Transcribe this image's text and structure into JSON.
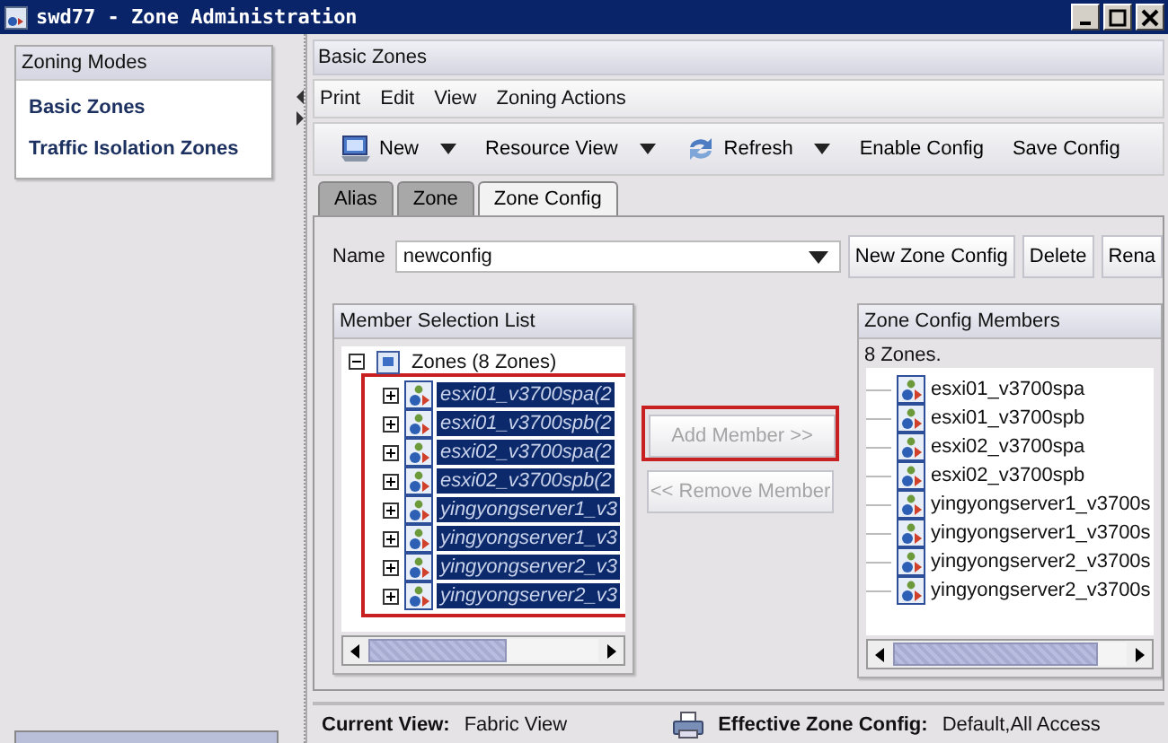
{
  "window": {
    "title": "swd77 - Zone Administration"
  },
  "sidebar": {
    "title": "Zoning Modes",
    "items": [
      {
        "label": "Basic Zones"
      },
      {
        "label": "Traffic Isolation Zones"
      }
    ]
  },
  "main": {
    "title": "Basic Zones",
    "menu": [
      "Print",
      "Edit",
      "View",
      "Zoning Actions"
    ],
    "toolbar": [
      {
        "label": "New",
        "kind": "icon_dropdown"
      },
      {
        "label": "Resource View",
        "kind": "dropdown"
      },
      {
        "label": "Refresh",
        "kind": "icon_dropdown"
      },
      {
        "label": "Enable Config",
        "kind": "plain"
      },
      {
        "label": "Save Config",
        "kind": "plain"
      }
    ],
    "tabs": [
      {
        "label": "Alias",
        "selected": false
      },
      {
        "label": "Zone",
        "selected": false
      },
      {
        "label": "Zone Config",
        "selected": true
      }
    ],
    "name_field": {
      "label": "Name",
      "value": "newconfig"
    },
    "buttons": [
      "New Zone Config",
      "Delete",
      "Rena"
    ],
    "member_list": {
      "title": "Member Selection List",
      "highlighted": true,
      "root": {
        "label": "Zones (8 Zones)",
        "expanded": true,
        "children": [
          {
            "label": "esxi01_v3700spa(2",
            "selected": true,
            "expanded": false
          },
          {
            "label": "esxi01_v3700spb(2",
            "selected": true,
            "expanded": false
          },
          {
            "label": "esxi02_v3700spa(2",
            "selected": true,
            "expanded": false
          },
          {
            "label": "esxi02_v3700spb(2",
            "selected": true,
            "expanded": false
          },
          {
            "label": "yingyongserver1_v3",
            "selected": true,
            "expanded": false
          },
          {
            "label": "yingyongserver1_v3",
            "selected": true,
            "expanded": false
          },
          {
            "label": "yingyongserver2_v3",
            "selected": true,
            "expanded": false
          },
          {
            "label": "yingyongserver2_v3",
            "selected": true,
            "expanded": false
          }
        ]
      }
    },
    "add_button": {
      "label": "Add Member >>",
      "disabled": true,
      "highlighted": true
    },
    "remove_button": {
      "label": "<< Remove Member",
      "disabled": true
    },
    "config_members": {
      "title": "Zone Config Members",
      "summary": "8 Zones.",
      "items": [
        "esxi01_v3700spa",
        "esxi01_v3700spb",
        "esxi02_v3700spa",
        "esxi02_v3700spb",
        "yingyongserver1_v3700s",
        "yingyongserver1_v3700s",
        "yingyongserver2_v3700s",
        "yingyongserver2_v3700s"
      ]
    }
  },
  "status_bar": {
    "current_view_label": "Current View:",
    "current_view": "Fabric View",
    "effective_label": "Effective Zone Config:",
    "effective": "Default,All Access"
  }
}
